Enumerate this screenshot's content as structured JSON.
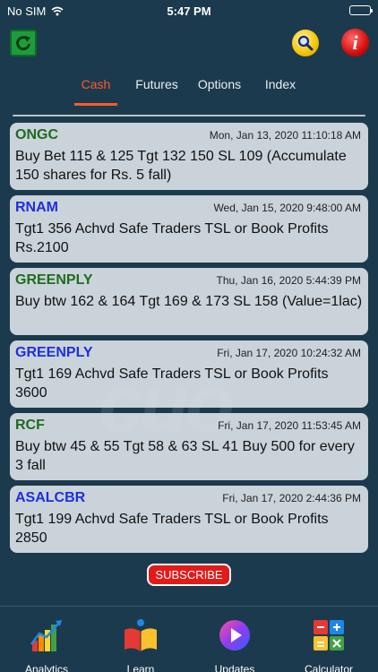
{
  "status": {
    "carrier": "No SIM",
    "time": "5:47 PM"
  },
  "tabs": [
    {
      "label": "Cash",
      "active": true
    },
    {
      "label": "Futures",
      "active": false
    },
    {
      "label": "Options",
      "active": false
    },
    {
      "label": "Index",
      "active": false
    }
  ],
  "watermark": "cuo",
  "messages": [
    {
      "symbol": "ONGC",
      "symbol_color": "green",
      "timestamp": "Mon, Jan 13, 2020  11:10:18 AM",
      "text": "Buy Bet 115 & 125 Tgt 132 150 SL 109 (Accumulate 150 shares for Rs. 5 fall)"
    },
    {
      "symbol": "RNAM",
      "symbol_color": "blue",
      "timestamp": "Wed, Jan 15, 2020  9:48:00 AM",
      "text": "Tgt1 356 Achvd Safe Traders TSL or Book Profits Rs.2100"
    },
    {
      "symbol": "GREENPLY",
      "symbol_color": "green",
      "timestamp": "Thu, Jan 16, 2020  5:44:39 PM",
      "text": "Buy btw 162 & 164 Tgt 169 & 173 SL 158 (Value=1lac)"
    },
    {
      "symbol": "GREENPLY",
      "symbol_color": "blue",
      "timestamp": "Fri, Jan 17, 2020  10:24:32 AM",
      "text": "Tgt1 169 Achvd Safe Traders TSL or Book Profits 3600"
    },
    {
      "symbol": "RCF",
      "symbol_color": "green",
      "timestamp": "Fri, Jan 17, 2020  11:53:45 AM",
      "text": "Buy btw 45 & 55 Tgt 58 & 63 SL 41 Buy 500 for every 3 fall"
    },
    {
      "symbol": "ASALCBR",
      "symbol_color": "blue",
      "timestamp": "Fri, Jan 17, 2020  2:44:36 PM",
      "text": "Tgt1 199 Achvd Safe Traders TSL or Book Profits 2850"
    }
  ],
  "subscribe_label": "SUBSCRIBE",
  "bottom_nav": [
    {
      "label": "Analytics",
      "icon": "analytics-icon"
    },
    {
      "label": "Learn",
      "icon": "book-icon"
    },
    {
      "label": "Updates",
      "icon": "updates-icon"
    },
    {
      "label": "Calculator",
      "icon": "calculator-icon"
    }
  ],
  "colors": {
    "background": "#1c3a4d",
    "accent": "#ff5a2a",
    "green_symbol": "#1f6b1f",
    "blue_symbol": "#1c2fe0",
    "subscribe": "#e31a1a"
  }
}
